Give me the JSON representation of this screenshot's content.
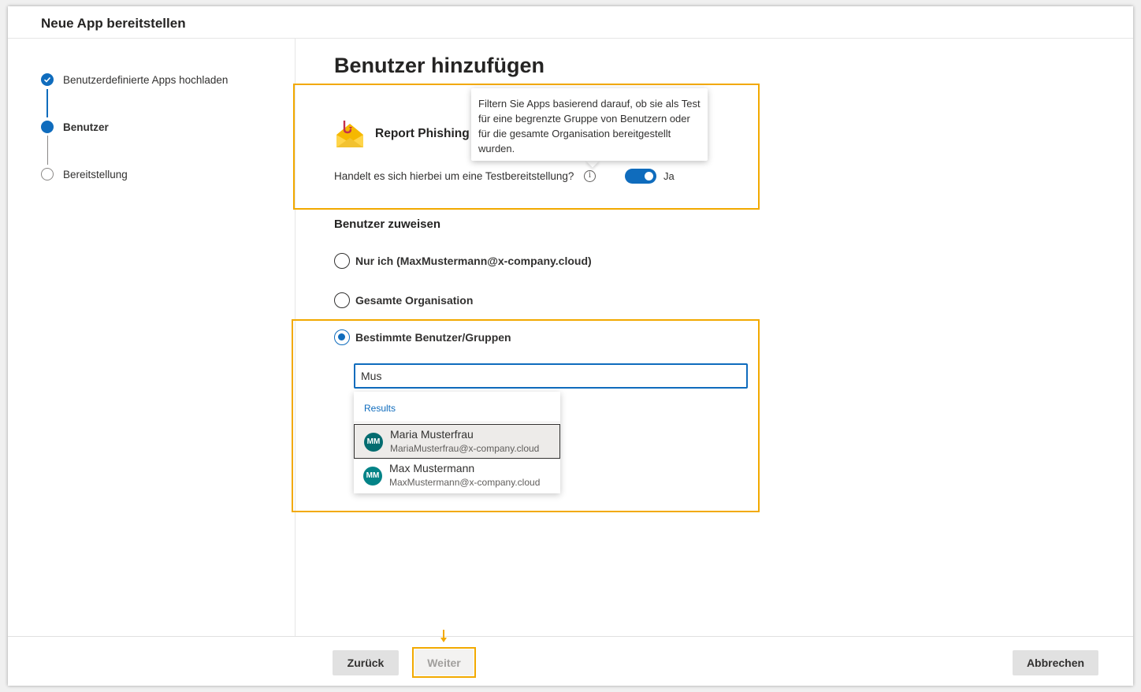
{
  "window": {
    "title": "Neue App bereitstellen"
  },
  "stepper": {
    "steps": [
      {
        "label": "Benutzerdefinierte Apps hochladen",
        "state": "done"
      },
      {
        "label": "Benutzer",
        "state": "current"
      },
      {
        "label": "Bereitstellung",
        "state": "pending"
      }
    ]
  },
  "main": {
    "heading": "Benutzer hinzufügen",
    "app": {
      "name": "Report Phishing",
      "icon": "envelope-hook-icon"
    },
    "test_question": "Handelt es sich hierbei um eine Testbereitstellung?",
    "toggle": {
      "value": true,
      "label": "Ja"
    },
    "tooltip": "Filtern Sie Apps basierend darauf, ob sie als Test für eine begrenzte Gruppe von Benutzern oder für die gesamte Organisation bereitgestellt wurden.",
    "assign_title": "Benutzer zuweisen",
    "options": [
      {
        "label": "Nur ich (MaxMustermann@x-company.cloud)",
        "checked": false
      },
      {
        "label": "Gesamte Organisation",
        "checked": false
      },
      {
        "label": "Bestimmte Benutzer/Gruppen",
        "checked": true
      }
    ],
    "search": {
      "value": "Mus"
    },
    "dropdown": {
      "results_label": "Results",
      "people": [
        {
          "initials": "MM",
          "name": "Maria Musterfrau",
          "email": "MariaMusterfrau@x-company.cloud",
          "selected": true
        },
        {
          "initials": "MM",
          "name": "Max Mustermann",
          "email": "MaxMustermann@x-company.cloud",
          "selected": false
        }
      ]
    }
  },
  "footer": {
    "back_label": "Zurück",
    "next_label": "Weiter",
    "cancel_label": "Abbrechen"
  },
  "colors": {
    "accent": "#0f6cbd",
    "highlight": "#f2a900"
  }
}
